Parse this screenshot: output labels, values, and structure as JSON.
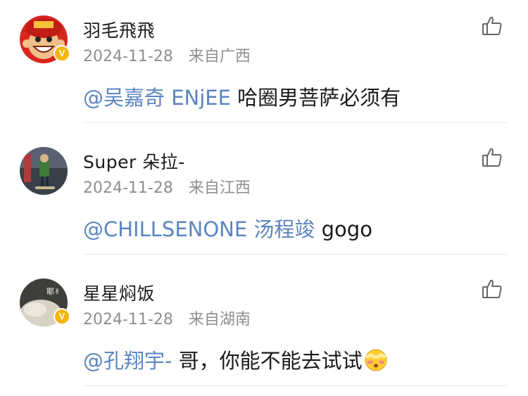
{
  "comments": [
    {
      "username": "羽毛飛飛",
      "date": "2024-11-28",
      "location": "来自广西",
      "mention": "@吴嘉奇 ENjEE",
      "text": " 哈圈男菩萨必须有",
      "verified": true
    },
    {
      "username": "Super 朵拉-",
      "date": "2024-11-28",
      "location": "来自江西",
      "mention": "@CHILLSENONE 汤程竣",
      "text": " gogo",
      "verified": false
    },
    {
      "username": "星星焖饭",
      "date": "2024-11-28",
      "location": "来自湖南",
      "mention": "@孔翔宇-",
      "text": " 哥，你能不能去试试",
      "verified": true,
      "avatar_text": "耶✌"
    }
  ],
  "icons": {
    "like": "thumbs-up-icon",
    "verified": "verified-badge-icon",
    "emoji": "shy-face-emoji"
  },
  "colors": {
    "mention": "#5b85c0",
    "meta": "#8e8e8e",
    "badge": "#f5b50a"
  }
}
